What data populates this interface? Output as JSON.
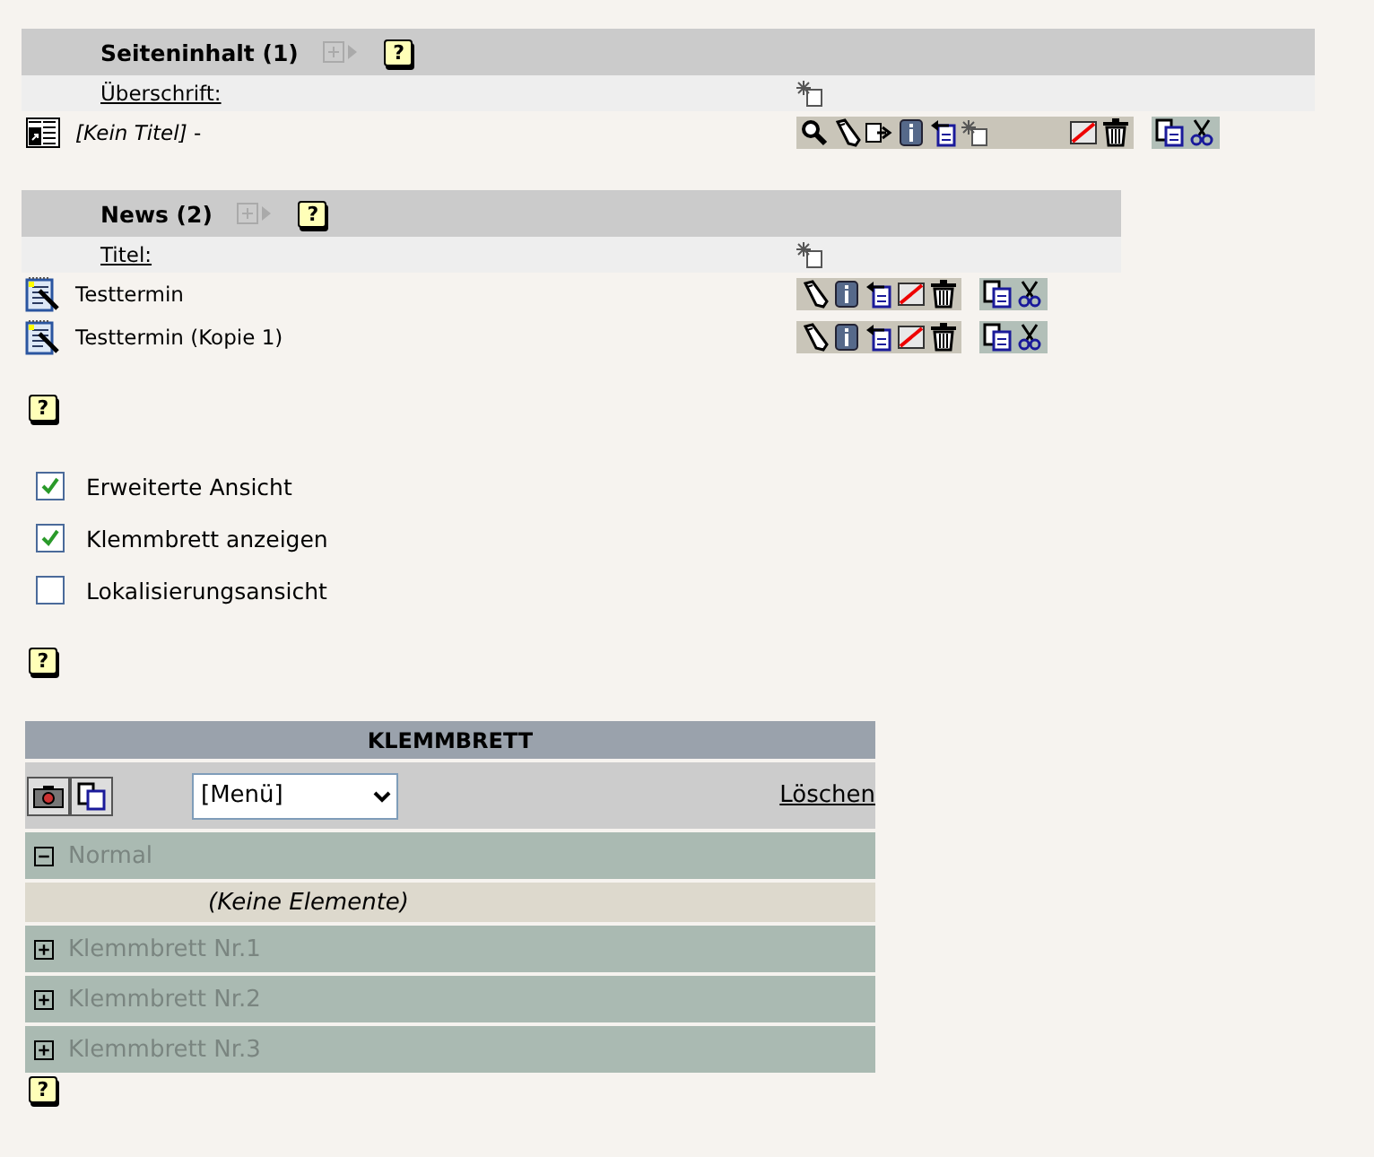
{
  "tables": [
    {
      "title": "Seiteninhalt (1)",
      "help": "?",
      "column": "Überschrift:",
      "records": [
        {
          "kind": "content",
          "title": "*[Kein Titel]* -",
          "actions": [
            {
              "kind": "view"
            },
            {
              "kind": "edit"
            },
            {
              "kind": "move"
            },
            {
              "kind": "info"
            },
            {
              "kind": "history"
            },
            {
              "kind": "new"
            },
            {
              "kind": "gap"
            },
            {
              "kind": "hide"
            },
            {
              "kind": "delete"
            }
          ],
          "clip": [
            {
              "kind": "copy"
            },
            {
              "kind": "cut"
            }
          ]
        }
      ]
    },
    {
      "title": "News (2)",
      "help": "?",
      "column": "Titel:",
      "records": [
        {
          "kind": "news",
          "title": "Testtermin",
          "actions": [
            {
              "kind": "edit"
            },
            {
              "kind": "info"
            },
            {
              "kind": "history"
            },
            {
              "kind": "hide"
            },
            {
              "kind": "delete"
            }
          ],
          "clip": [
            {
              "kind": "copy"
            },
            {
              "kind": "cut"
            }
          ]
        },
        {
          "kind": "news",
          "title": "Testtermin (Kopie 1)",
          "actions": [
            {
              "kind": "edit"
            },
            {
              "kind": "info"
            },
            {
              "kind": "history"
            },
            {
              "kind": "hide"
            },
            {
              "kind": "delete"
            }
          ],
          "clip": [
            {
              "kind": "copy"
            },
            {
              "kind": "cut"
            }
          ]
        }
      ]
    }
  ],
  "help_after_tables": "?",
  "options": [
    {
      "label": "Erweiterte Ansicht",
      "checked": true
    },
    {
      "label": "Klemmbrett anzeigen",
      "checked": true
    },
    {
      "label": "Lokalisierungsansicht",
      "checked": false
    }
  ],
  "help_after_options": "?",
  "clipboard": {
    "title": "KLEMMBRETT",
    "menu": "[Menü]",
    "clear": "Löschen",
    "pads": [
      {
        "label": "Normal",
        "expanded": true,
        "note": "(Keine Elemente)"
      },
      {
        "label": "Klemmbrett Nr.1",
        "expanded": false
      },
      {
        "label": "Klemmbrett Nr.2",
        "expanded": false
      },
      {
        "label": "Klemmbrett Nr.3",
        "expanded": false
      }
    ],
    "help": "?"
  }
}
